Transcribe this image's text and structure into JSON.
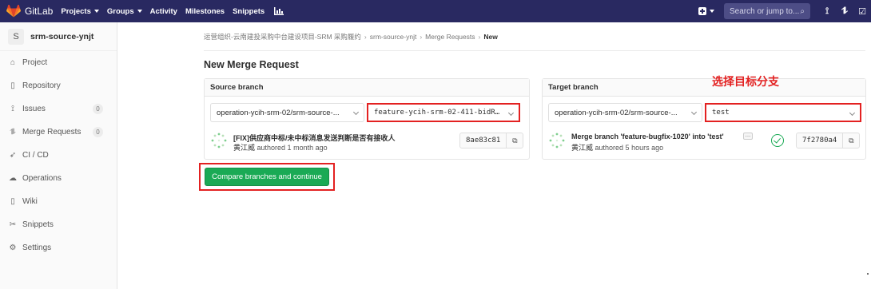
{
  "app": {
    "name": "GitLab"
  },
  "nav": {
    "projects": "Projects",
    "groups": "Groups",
    "activity": "Activity",
    "milestones": "Milestones",
    "snippets": "Snippets",
    "search_placeholder": "Search or jump to..."
  },
  "sidebar": {
    "avatar_letter": "S",
    "project_name": "srm-source-ynjt",
    "items": [
      {
        "label": "Project",
        "icon": "home-icon"
      },
      {
        "label": "Repository",
        "icon": "book-icon"
      },
      {
        "label": "Issues",
        "icon": "issues-icon",
        "count": "0"
      },
      {
        "label": "Merge Requests",
        "icon": "merge-request-icon",
        "count": "0"
      },
      {
        "label": "CI / CD",
        "icon": "rocket-icon"
      },
      {
        "label": "Operations",
        "icon": "cloud-gear-icon"
      },
      {
        "label": "Wiki",
        "icon": "book-icon"
      },
      {
        "label": "Snippets",
        "icon": "scissors-icon"
      },
      {
        "label": "Settings",
        "icon": "gear-icon"
      }
    ]
  },
  "breadcrumb": {
    "group": "运营组织-云南建投采购中台建设项目-SRM 采购履约",
    "project": "srm-source-ynjt",
    "section": "Merge Requests",
    "current": "New"
  },
  "page": {
    "title": "New Merge Request"
  },
  "source": {
    "header": "Source branch",
    "project_select": "operation-ycih-srm-02/srm-source-...",
    "branch_select": "feature-ycih-srm-02-411-bidR…",
    "commit_title": "[FIX]供应商中标/未中标消息发送判断是否有接收人",
    "commit_author": "黄江威",
    "commit_meta": "authored 1 month ago",
    "sha": "8ae83c81"
  },
  "target": {
    "header": "Target branch",
    "project_select": "operation-ycih-srm-02/srm-source-...",
    "branch_select": "test",
    "commit_title": "Merge branch 'feature-bugfix-1020' into 'test'",
    "commit_author": "黄江威",
    "commit_meta": "authored 5 hours ago",
    "sha": "7f2780a4"
  },
  "annotation": "选择目标分支",
  "compare_button": "Compare branches and continue",
  "colors": {
    "nav": "#292961",
    "accent": "#1aaa55",
    "highlight": "#e32121"
  }
}
